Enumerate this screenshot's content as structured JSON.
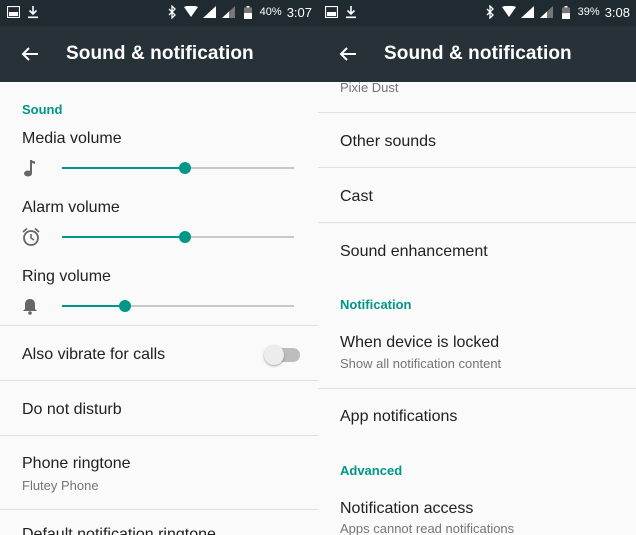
{
  "left": {
    "status": {
      "battery": "40%",
      "time": "3:07"
    },
    "toolbar": {
      "title": "Sound & notification"
    },
    "section_sound": "Sound",
    "media_volume": {
      "label": "Media volume",
      "level": 0.53,
      "icon": "music-note-icon"
    },
    "alarm_volume": {
      "label": "Alarm volume",
      "level": 0.53,
      "icon": "alarm-clock-icon"
    },
    "ring_volume": {
      "label": "Ring volume",
      "level": 0.27,
      "icon": "bell-icon"
    },
    "vibrate": {
      "label": "Also vibrate for calls",
      "enabled": false
    },
    "dnd": {
      "label": "Do not disturb"
    },
    "ringtone": {
      "label": "Phone ringtone",
      "value": "Flutey Phone"
    },
    "default_notification": {
      "label": "Default notification ringtone"
    }
  },
  "right": {
    "status": {
      "battery": "39%",
      "time": "3:08"
    },
    "toolbar": {
      "title": "Sound & notification"
    },
    "partial_item": "Pixie Dust",
    "other_sounds": "Other sounds",
    "cast": "Cast",
    "sound_enhancement": "Sound enhancement",
    "section_notification": "Notification",
    "locked": {
      "label": "When device is locked",
      "value": "Show all notification content"
    },
    "app_notifications": "App notifications",
    "section_advanced": "Advanced",
    "notification_access": {
      "label": "Notification access",
      "value": "Apps cannot read notifications"
    }
  },
  "colors": {
    "accent": "#009688",
    "toolbar": "#263238",
    "statusbar": "#1f2b30"
  }
}
